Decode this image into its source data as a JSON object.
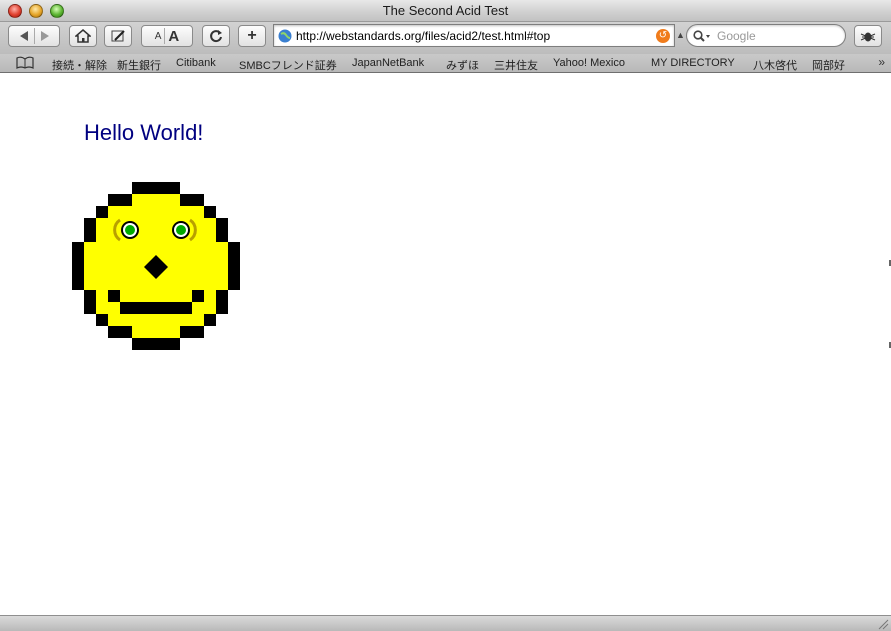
{
  "window": {
    "title": "The Second Acid Test"
  },
  "toolbar": {
    "text_small": "A",
    "text_large": "A",
    "add_label": "+",
    "url": "http://webstandards.org/files/acid2/test.html#top",
    "search_placeholder": "Google"
  },
  "bookmarks": {
    "items": [
      "接続・解除",
      "新生銀行",
      "Citibank",
      "SMBCフレンド証券",
      "JapanNetBank",
      "みずほ",
      "三井住友",
      "Yahoo! Mexico",
      "MY DIRECTORY",
      "八木啓代",
      "岡部好"
    ],
    "more": "»"
  },
  "page": {
    "heading": "Hello World!",
    "heading_color": "#000080",
    "face_color": "#ffff00",
    "eye_color": "#00aa00"
  }
}
